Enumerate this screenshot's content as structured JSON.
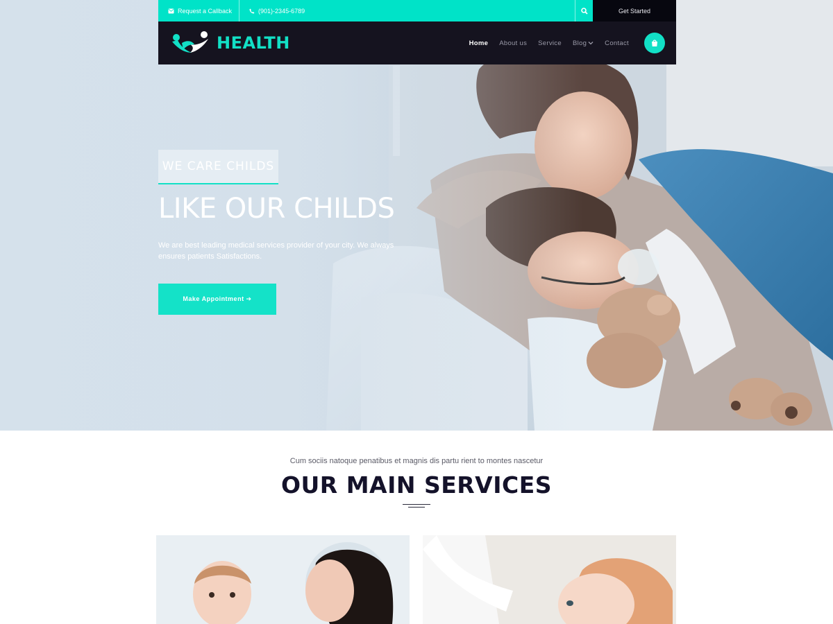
{
  "topbar": {
    "callback_label": "Request a Callback",
    "phone": "(901)-2345-6789",
    "get_started_label": "Get Started"
  },
  "brand": {
    "name": "HEALTH"
  },
  "nav": {
    "items": [
      {
        "label": "Home"
      },
      {
        "label": "About us"
      },
      {
        "label": "Service"
      },
      {
        "label": "Blog"
      },
      {
        "label": "Contact"
      }
    ]
  },
  "hero": {
    "tagline": "WE CARE CHILDS",
    "title": "LIKE OUR CHILDS",
    "description": "We are best leading medical services provider of your city. We always ensures patients Satisfactions.",
    "cta_label": "Make Appointment ➔"
  },
  "services": {
    "subtitle": "Cum sociis natoque penatibus et magnis dis partu rient to montes nascetur",
    "title": "OUR MAIN SERVICES"
  },
  "colors": {
    "accent": "#00e3c8",
    "dark": "#15131f",
    "heading": "#14122a"
  }
}
